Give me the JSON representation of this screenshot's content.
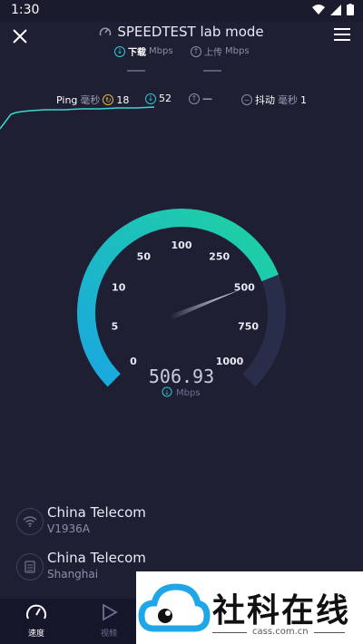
{
  "status_bar": {
    "time": "1:30",
    "icons": [
      "wifi-icon",
      "signal-icon",
      "battery-icon"
    ]
  },
  "header": {
    "title": "SPEEDTEST lab mode",
    "close_icon": "close-icon",
    "menu_icon": "menu-icon"
  },
  "download": {
    "label": "下载",
    "unit": "Mbps",
    "value": "—"
  },
  "upload": {
    "label": "上传",
    "unit": "Mbps",
    "value": "—"
  },
  "metrics": {
    "ping_label": "Ping",
    "ping_unit": "毫秒",
    "ping_value": "18",
    "download_latency": "52",
    "upload_latency": "—",
    "jitter_label": "抖动",
    "jitter_unit": "毫秒",
    "jitter_value": "1"
  },
  "gauge": {
    "ticks": [
      "0",
      "5",
      "10",
      "50",
      "100",
      "250",
      "500",
      "750",
      "1000"
    ],
    "current_value": "506.93",
    "current_value_num": 506.93,
    "unit": "Mbps",
    "accent_start": "#1aa7e0",
    "accent_end": "#1fd3a0"
  },
  "isp": [
    {
      "name": "China Telecom",
      "detail": "V1936A",
      "icon": "wifi-icon"
    },
    {
      "name": "China Telecom",
      "detail": "Shanghai",
      "icon": "server-icon"
    }
  ],
  "bottom_nav": {
    "items": [
      {
        "label": "速度",
        "icon": "speedometer-icon",
        "active": true
      },
      {
        "label": "视频",
        "icon": "play-icon",
        "active": false
      }
    ]
  },
  "watermark": {
    "text": "社科在线",
    "url": "cass.com.cn",
    "colors": {
      "cloud": "#1fa6e6",
      "accent": "#111111"
    }
  }
}
